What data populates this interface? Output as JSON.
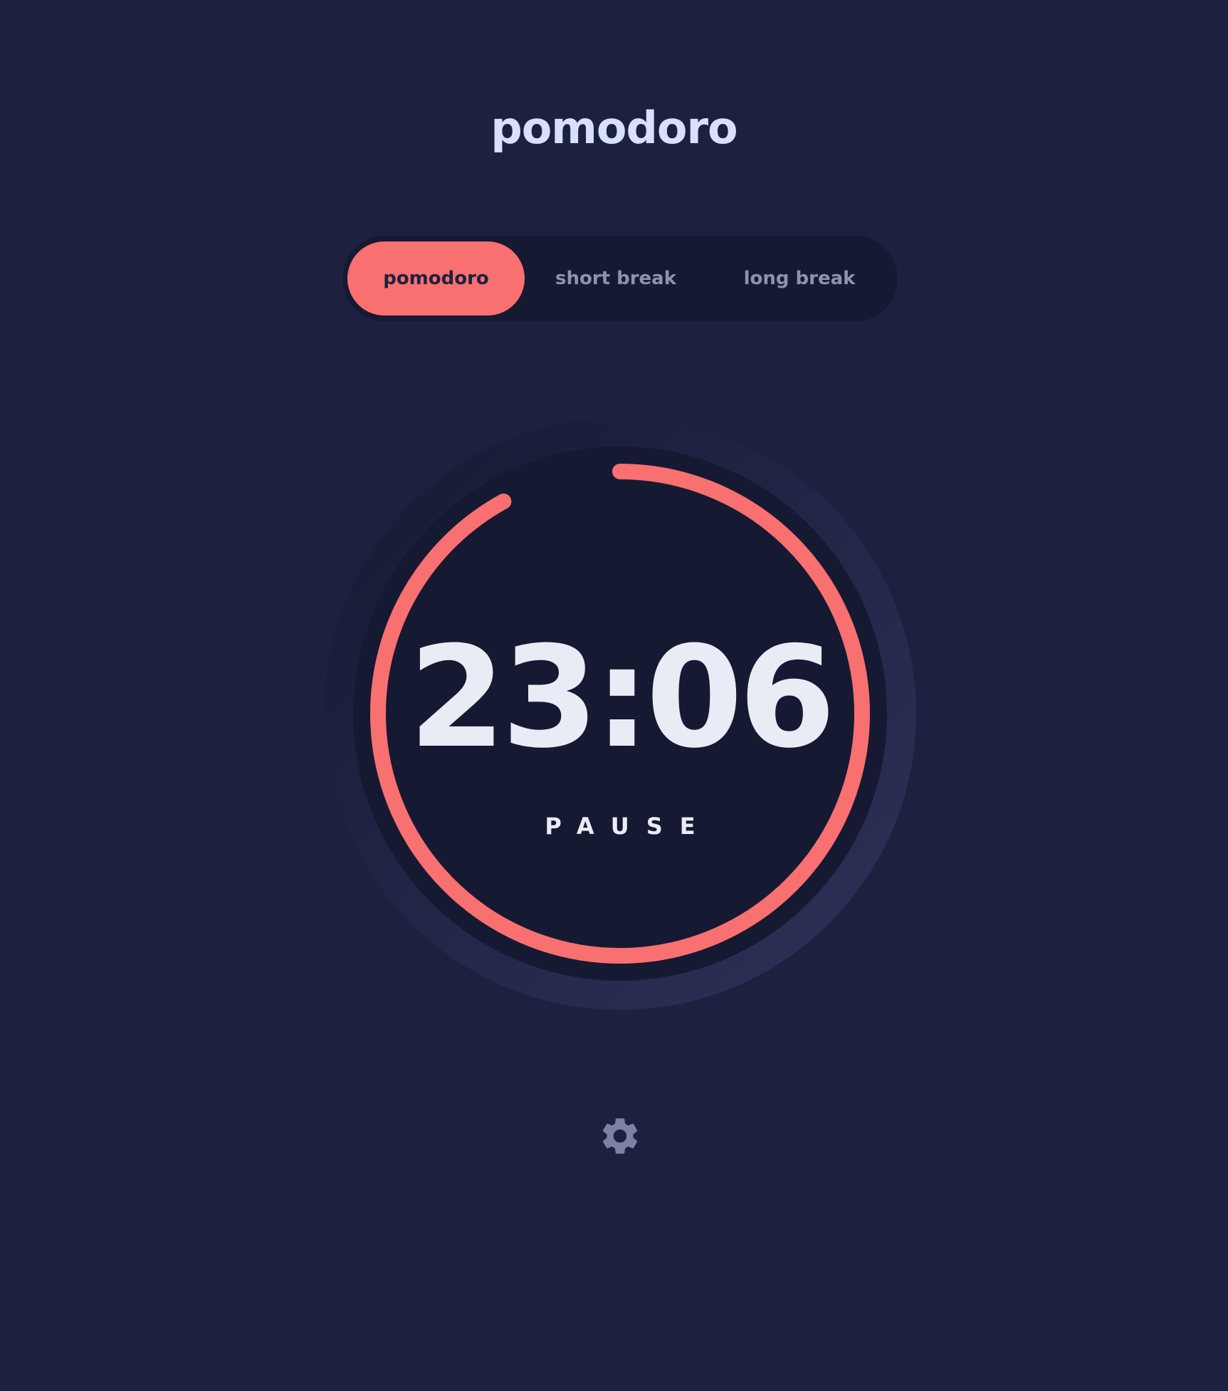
{
  "app": {
    "title": "pomodoro"
  },
  "mode_tabs": [
    {
      "label": "pomodoro",
      "active": true
    },
    {
      "label": "short break",
      "active": false
    },
    {
      "label": "long break",
      "active": false
    }
  ],
  "timer": {
    "time": "23:06",
    "action_label": "PAUSE",
    "progress_fraction": 0.92
  },
  "icons": {
    "settings": "gear-icon"
  },
  "colors": {
    "background": "#1e2040",
    "panel": "#161932",
    "accent": "#f87070",
    "title": "#d7e0ff",
    "tab_inactive": "#8e93ab",
    "icon": "#7c82a3"
  }
}
